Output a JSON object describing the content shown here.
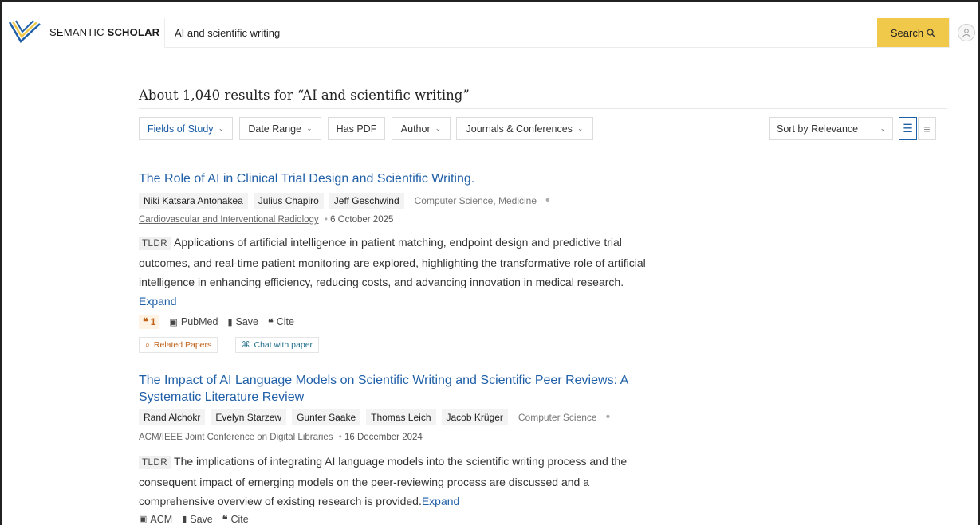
{
  "header": {
    "brand_light": "SEMANTIC ",
    "brand_bold": "SCHOLAR",
    "search_value": "AI and scientific writing",
    "search_button": "Search"
  },
  "results": {
    "summary": "About 1,040 results for “AI and scientific writing”"
  },
  "filters": {
    "fields": "Fields of Study",
    "date": "Date Range",
    "pdf": "Has PDF",
    "author": "Author",
    "journals": "Journals & Conferences",
    "sort": "Sort by Relevance"
  },
  "papers": [
    {
      "title": "The Role of AI in Clinical Trial Design and Scientific Writing.",
      "authors": [
        "Niki Katsara Antonakea",
        "Julius Chapiro",
        "Jeff Geschwind"
      ],
      "fields": "Computer Science, Medicine",
      "venue": "Cardiovascular and Interventional Radiology",
      "date": "6 October 2025",
      "tldr_label": "TLDR",
      "tldr": "Applications of artificial intelligence in patient matching, endpoint design and predictive trial outcomes, and real-time patient monitoring are explored, highlighting the transformative role of artificial intelligence in enhancing efficiency, reducing costs, and advancing innovation in medical research.",
      "expand": "Expand",
      "citations": "1",
      "source": "PubMed",
      "save": "Save",
      "cite": "Cite",
      "related": "Related Papers",
      "chat": "Chat with paper"
    },
    {
      "title": "The Impact of AI Language Models on Scientific Writing and Scientific Peer Reviews: A Systematic Literature Review",
      "authors": [
        "Rand Alchokr",
        "Evelyn Starzew",
        "Gunter Saake",
        "Thomas Leich",
        "Jacob Krüger"
      ],
      "fields": "Computer Science",
      "venue": "ACM/IEEE Joint Conference on Digital Libraries",
      "date": "16 December 2024",
      "tldr_label": "TLDR",
      "tldr": "The implications of integrating AI language models into the scientific writing process and the consequent impact of emerging models on the peer-reviewing process are discussed and a comprehensive overview of existing research is provided.",
      "expand": "Expand",
      "source": "ACM",
      "save": "Save",
      "cite": "Cite"
    }
  ],
  "colors": {
    "accent_yellow": "#f0c94a",
    "link_blue": "#1f5fa8",
    "citation_orange": "#c0621a"
  }
}
